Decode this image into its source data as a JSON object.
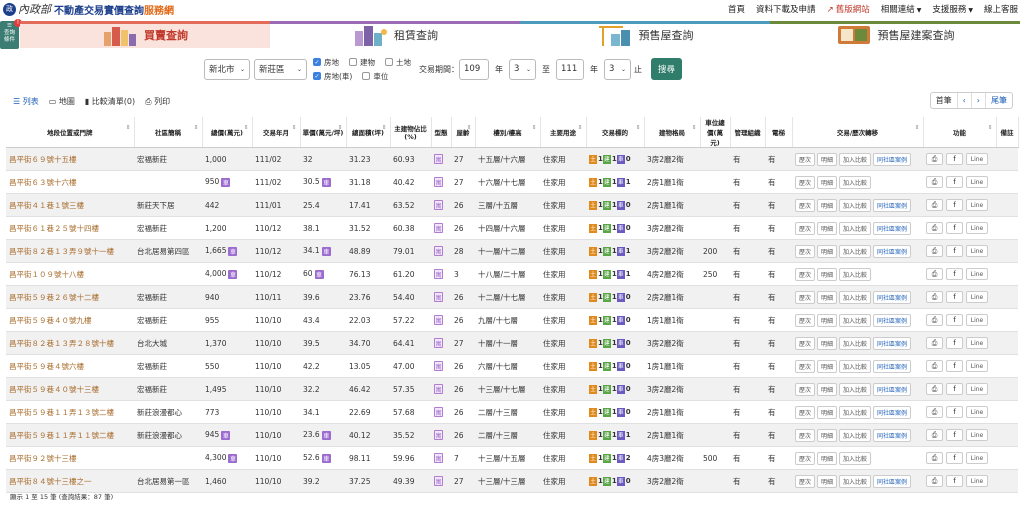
{
  "header": {
    "seal": "政",
    "ministry": "內政部",
    "site_title": "不動產交易實價查詢",
    "site_title_accent": "服務網",
    "nav": [
      "首頁",
      "資料下載及申請",
      "舊版網站",
      "相關連結",
      "支援服務",
      "線上客服"
    ]
  },
  "filter_toggle": {
    "label": "查詢條件",
    "badge": "!"
  },
  "tabs": [
    "買賣查詢",
    "租賃查詢",
    "預售屋查詢",
    "預售屋建案查詢"
  ],
  "search": {
    "city": "新北市",
    "district": "新莊區",
    "checks": [
      {
        "label": "房地",
        "on": true
      },
      {
        "label": "建物",
        "on": false
      },
      {
        "label": "土地",
        "on": false
      },
      {
        "label": "房地(車)",
        "on": true
      },
      {
        "label": "車位",
        "on": false
      }
    ],
    "period_label": "交易期間：",
    "from_year": "109",
    "year_unit": "年",
    "from_month": "3",
    "to_label": "至",
    "to_year": "111",
    "to_month": "3",
    "end_label": "止",
    "submit": "搜尋"
  },
  "view": {
    "list": "列表",
    "map": "地圖",
    "compare": "比較清單(0)",
    "print": "列印"
  },
  "pager": {
    "first": "首筆",
    "prev": "‹",
    "next": "›",
    "last": "尾筆"
  },
  "columns": [
    "地段位置或門牌",
    "社區簡稱",
    "總價(萬元)",
    "交易年月",
    "單價(萬元/坪)",
    "總面積(坪)",
    "主建物佔比(%)",
    "型態",
    "屋齡",
    "樓別/樓高",
    "主要用途",
    "交易標的",
    "建物格局",
    "車位總價(萬元)",
    "管理組織",
    "電梯",
    "交易/歷次轉移",
    "功能",
    "備註"
  ],
  "row_buttons": {
    "history": "歷次",
    "detail": "明細",
    "compare": "加入比較",
    "same": "同社區案例",
    "line": "Line",
    "type_icon": "寓",
    "car": "車"
  },
  "rows": [
    {
      "addr": "昌平街６９號十五樓",
      "comm": "宏福新莊",
      "price": "1,000",
      "car": false,
      "ym": "111/02",
      "unit": "32",
      "area": "31.23",
      "ratio": "60.93",
      "age": "27",
      "floor": "十五層/十六層",
      "use": "住家用",
      "tg": [
        "1",
        "1",
        "0"
      ],
      "layout": "3房2廳2衛",
      "carprice": "",
      "mgmt": "有",
      "elev": "有",
      "same": true
    },
    {
      "addr": "昌平街６３號十六樓",
      "comm": "",
      "price": "950",
      "car": true,
      "ym": "111/02",
      "unit": "30.5",
      "area": "31.18",
      "ratio": "40.42",
      "age": "27",
      "floor": "十六層/十七層",
      "use": "住家用",
      "tg": [
        "1",
        "1",
        "1"
      ],
      "layout": "2房1廳1衛",
      "carprice": "",
      "mgmt": "有",
      "elev": "有",
      "same": false
    },
    {
      "addr": "昌平街４１巷１號三樓",
      "comm": "新莊天下居",
      "price": "442",
      "car": false,
      "ym": "111/01",
      "unit": "25.4",
      "area": "17.41",
      "ratio": "63.52",
      "age": "26",
      "floor": "三層/十五層",
      "use": "住家用",
      "tg": [
        "1",
        "1",
        "0"
      ],
      "layout": "2房1廳1衛",
      "carprice": "",
      "mgmt": "有",
      "elev": "有",
      "same": true
    },
    {
      "addr": "昌平街６１巷２５號十四樓",
      "comm": "宏福新莊",
      "price": "1,200",
      "car": false,
      "ym": "110/12",
      "unit": "38.1",
      "area": "31.52",
      "ratio": "60.38",
      "age": "26",
      "floor": "十四層/十六層",
      "use": "住家用",
      "tg": [
        "1",
        "1",
        "0"
      ],
      "layout": "3房2廳2衛",
      "carprice": "",
      "mgmt": "有",
      "elev": "有",
      "same": true
    },
    {
      "addr": "昌平街８２巷１３弄９號十一樓",
      "comm": "台北居易第四區",
      "price": "1,665",
      "car": true,
      "ym": "110/12",
      "unit": "34.1",
      "area": "48.89",
      "ratio": "79.01",
      "age": "28",
      "floor": "十一層/十二層",
      "use": "住家用",
      "tg": [
        "1",
        "1",
        "1"
      ],
      "layout": "3房2廳2衛",
      "carprice": "200",
      "mgmt": "有",
      "elev": "有",
      "same": true
    },
    {
      "addr": "昌平街１０９號十八樓",
      "comm": "",
      "price": "4,000",
      "car": true,
      "ym": "110/12",
      "unit": "60",
      "area": "76.13",
      "ratio": "61.20",
      "age": "3",
      "floor": "十八層/二十層",
      "use": "住家用",
      "tg": [
        "1",
        "1",
        "1"
      ],
      "layout": "4房2廳2衛",
      "carprice": "250",
      "mgmt": "有",
      "elev": "有",
      "same": false
    },
    {
      "addr": "昌平街５９巷２６號十二樓",
      "comm": "宏福新莊",
      "price": "940",
      "car": false,
      "ym": "110/11",
      "unit": "39.6",
      "area": "23.76",
      "ratio": "54.40",
      "age": "26",
      "floor": "十二層/十七層",
      "use": "住家用",
      "tg": [
        "1",
        "1",
        "0"
      ],
      "layout": "2房2廳1衛",
      "carprice": "",
      "mgmt": "有",
      "elev": "有",
      "same": true
    },
    {
      "addr": "昌平街５９巷４０號九樓",
      "comm": "宏福新莊",
      "price": "955",
      "car": false,
      "ym": "110/10",
      "unit": "43.4",
      "area": "22.03",
      "ratio": "57.22",
      "age": "26",
      "floor": "九層/十七層",
      "use": "住家用",
      "tg": [
        "1",
        "1",
        "0"
      ],
      "layout": "1房1廳1衛",
      "carprice": "",
      "mgmt": "有",
      "elev": "有",
      "same": true
    },
    {
      "addr": "昌平街８２巷１３弄２８號十樓",
      "comm": "台北大城",
      "price": "1,370",
      "car": false,
      "ym": "110/10",
      "unit": "39.5",
      "area": "34.70",
      "ratio": "64.41",
      "age": "27",
      "floor": "十層/十一層",
      "use": "住家用",
      "tg": [
        "1",
        "1",
        "0"
      ],
      "layout": "3房2廳2衛",
      "carprice": "",
      "mgmt": "有",
      "elev": "有",
      "same": true
    },
    {
      "addr": "昌平街５９巷４號六樓",
      "comm": "宏福新莊",
      "price": "550",
      "car": false,
      "ym": "110/10",
      "unit": "42.2",
      "area": "13.05",
      "ratio": "47.00",
      "age": "26",
      "floor": "六層/十七層",
      "use": "住家用",
      "tg": [
        "1",
        "1",
        "0"
      ],
      "layout": "1房1廳1衛",
      "carprice": "",
      "mgmt": "有",
      "elev": "有",
      "same": true
    },
    {
      "addr": "昌平街５９巷４０號十三樓",
      "comm": "宏福新莊",
      "price": "1,495",
      "car": false,
      "ym": "110/10",
      "unit": "32.2",
      "area": "46.42",
      "ratio": "57.35",
      "age": "26",
      "floor": "十三層/十七層",
      "use": "住家用",
      "tg": [
        "1",
        "1",
        "0"
      ],
      "layout": "3房2廳2衛",
      "carprice": "",
      "mgmt": "有",
      "elev": "有",
      "same": true
    },
    {
      "addr": "昌平街５９巷１１弄１３號二樓",
      "comm": "新莊浪漫都心",
      "price": "773",
      "car": false,
      "ym": "110/10",
      "unit": "34.1",
      "area": "22.69",
      "ratio": "57.68",
      "age": "26",
      "floor": "二層/十三層",
      "use": "住家用",
      "tg": [
        "1",
        "1",
        "0"
      ],
      "layout": "2房1廳1衛",
      "carprice": "",
      "mgmt": "有",
      "elev": "有",
      "same": true
    },
    {
      "addr": "昌平街５９巷１１弄１１號二樓",
      "comm": "新莊浪漫都心",
      "price": "945",
      "car": true,
      "ym": "110/10",
      "unit": "23.6",
      "area": "40.12",
      "ratio": "35.52",
      "age": "26",
      "floor": "二層/十三層",
      "use": "住家用",
      "tg": [
        "1",
        "1",
        "1"
      ],
      "layout": "2房1廳1衛",
      "carprice": "",
      "mgmt": "有",
      "elev": "有",
      "same": true
    },
    {
      "addr": "昌平街９２號十三樓",
      "comm": "",
      "price": "4,300",
      "car": true,
      "ym": "110/10",
      "unit": "52.6",
      "area": "98.11",
      "ratio": "59.96",
      "age": "7",
      "floor": "十三層/十五層",
      "use": "住家用",
      "tg": [
        "1",
        "1",
        "2"
      ],
      "layout": "4房3廳2衛",
      "carprice": "500",
      "mgmt": "有",
      "elev": "有",
      "same": false
    },
    {
      "addr": "昌平街８４號十三樓之一",
      "comm": "台北居易第一區",
      "price": "1,460",
      "car": false,
      "ym": "110/10",
      "unit": "39.2",
      "area": "37.25",
      "ratio": "49.39",
      "age": "27",
      "floor": "十三層/十三層",
      "use": "住家用",
      "tg": [
        "1",
        "1",
        "0"
      ],
      "layout": "3房2廳2衛",
      "carprice": "",
      "mgmt": "有",
      "elev": "有",
      "same": true
    }
  ],
  "footer": "顯示 1 至 15 筆 (查詢結果：87 筆)"
}
